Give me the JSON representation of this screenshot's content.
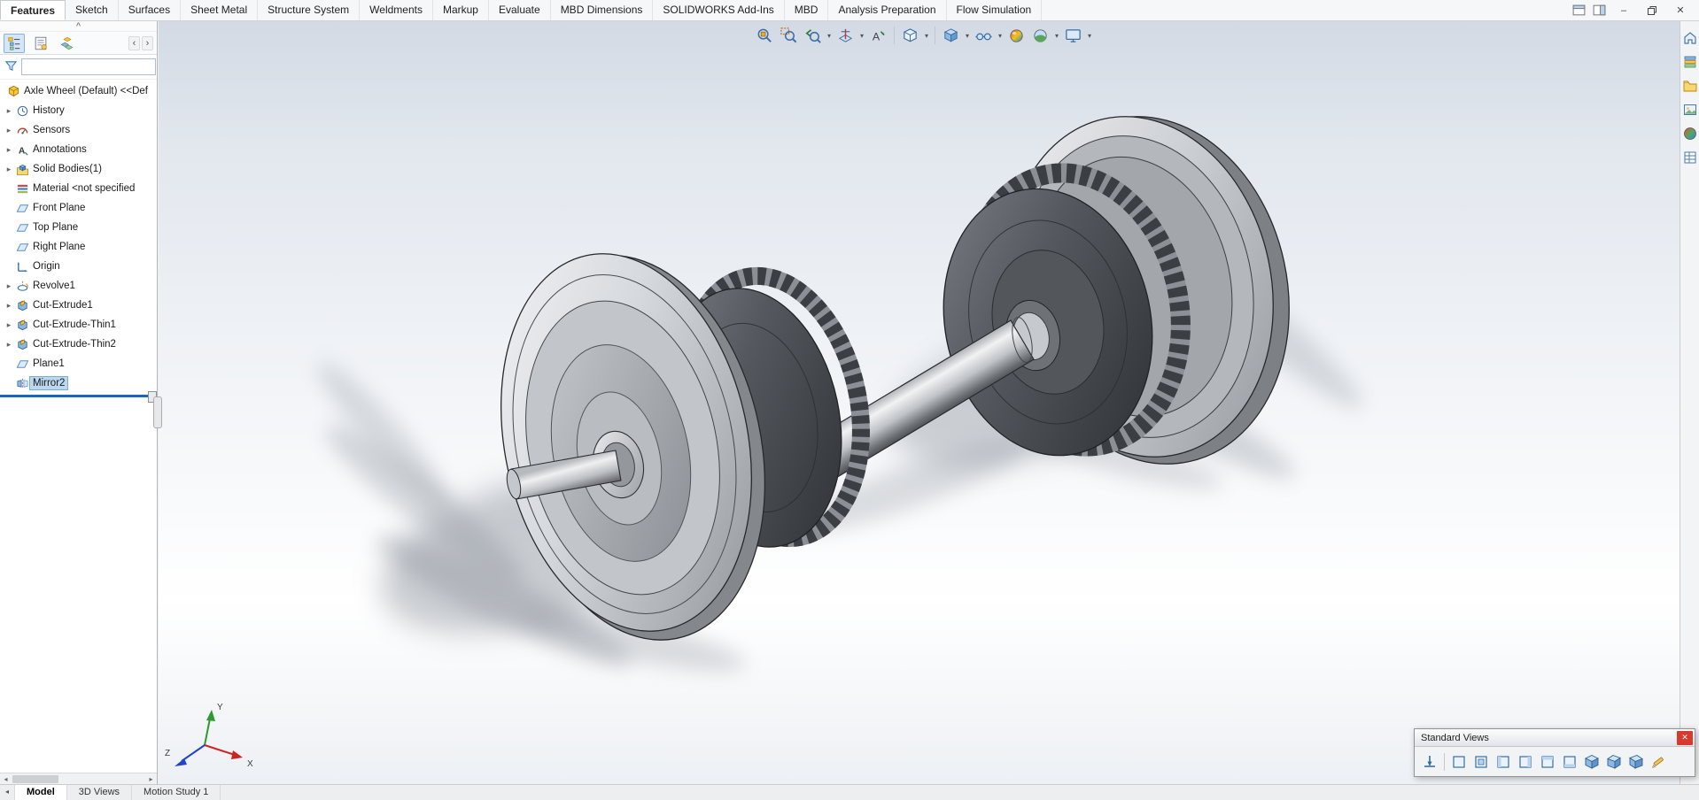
{
  "colors": {
    "accent_blue": "#1a66b8",
    "selection_blue": "#bcd8f0",
    "close_red": "#d83b2d",
    "viewport_top": "#d3dae4",
    "viewport_bottom": "#edf0f4"
  },
  "glyphs": {
    "expander": "▸",
    "dropdown": "▾",
    "scroll_left": "◂",
    "scroll_right": "▸",
    "chevron_left": "‹",
    "chevron_right": "›",
    "collapse_up": "^",
    "minimize": "–",
    "close": "✕"
  },
  "command_tabs": {
    "items": [
      "Features",
      "Sketch",
      "Surfaces",
      "Sheet Metal",
      "Structure System",
      "Weldments",
      "Markup",
      "Evaluate",
      "MBD Dimensions",
      "SOLIDWORKS Add-Ins",
      "MBD",
      "Analysis Preparation",
      "Flow Simulation"
    ],
    "active": "Features"
  },
  "feature_tree": {
    "root_label": "Axle Wheel (Default) <<Def",
    "items": [
      {
        "label": "History",
        "expandable": true
      },
      {
        "label": "Sensors",
        "expandable": true
      },
      {
        "label": "Annotations",
        "expandable": true
      },
      {
        "label": "Solid Bodies(1)",
        "expandable": true
      },
      {
        "label": "Material <not specified",
        "expandable": false
      },
      {
        "label": "Front Plane",
        "expandable": false
      },
      {
        "label": "Top Plane",
        "expandable": false
      },
      {
        "label": "Right Plane",
        "expandable": false
      },
      {
        "label": "Origin",
        "expandable": false
      },
      {
        "label": "Revolve1",
        "expandable": true
      },
      {
        "label": "Cut-Extrude1",
        "expandable": true
      },
      {
        "label": "Cut-Extrude-Thin1",
        "expandable": true
      },
      {
        "label": "Cut-Extrude-Thin2",
        "expandable": true
      },
      {
        "label": "Plane1",
        "expandable": false
      },
      {
        "label": "Mirror2",
        "expandable": false,
        "selected": true
      }
    ]
  },
  "viewport": {
    "triad": {
      "x": "X",
      "y": "Y",
      "z": "Z"
    }
  },
  "doc_tabs": {
    "items": [
      "Model",
      "3D Views",
      "Motion Study 1"
    ],
    "active": "Model"
  },
  "standard_views": {
    "title": "Standard Views"
  }
}
